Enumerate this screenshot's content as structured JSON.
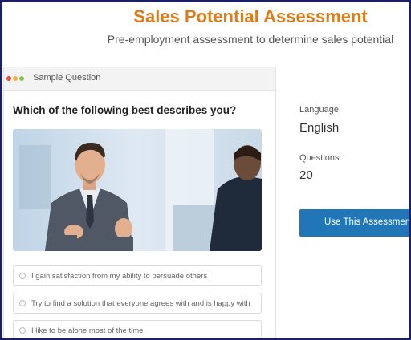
{
  "header": {
    "title": "Sales Potential Assessment",
    "subtitle": "Pre-employment assessment to determine sales potential"
  },
  "card": {
    "header_label": "Sample Question",
    "question": "Which of the following best describes you?",
    "options": [
      "I gain satisfaction from my ability to persuade others",
      "Try to find a solution that everyone agrees with and is happy with",
      "I like to be alone most of the time"
    ]
  },
  "sidebar": {
    "language_label": "Language:",
    "language_value": "English",
    "questions_label": "Questions:",
    "questions_value": "20",
    "button_label": "Use This Assessment"
  },
  "colors": {
    "title": "#e07b1a",
    "button": "#2176b8",
    "frame": "#1c1f66"
  }
}
